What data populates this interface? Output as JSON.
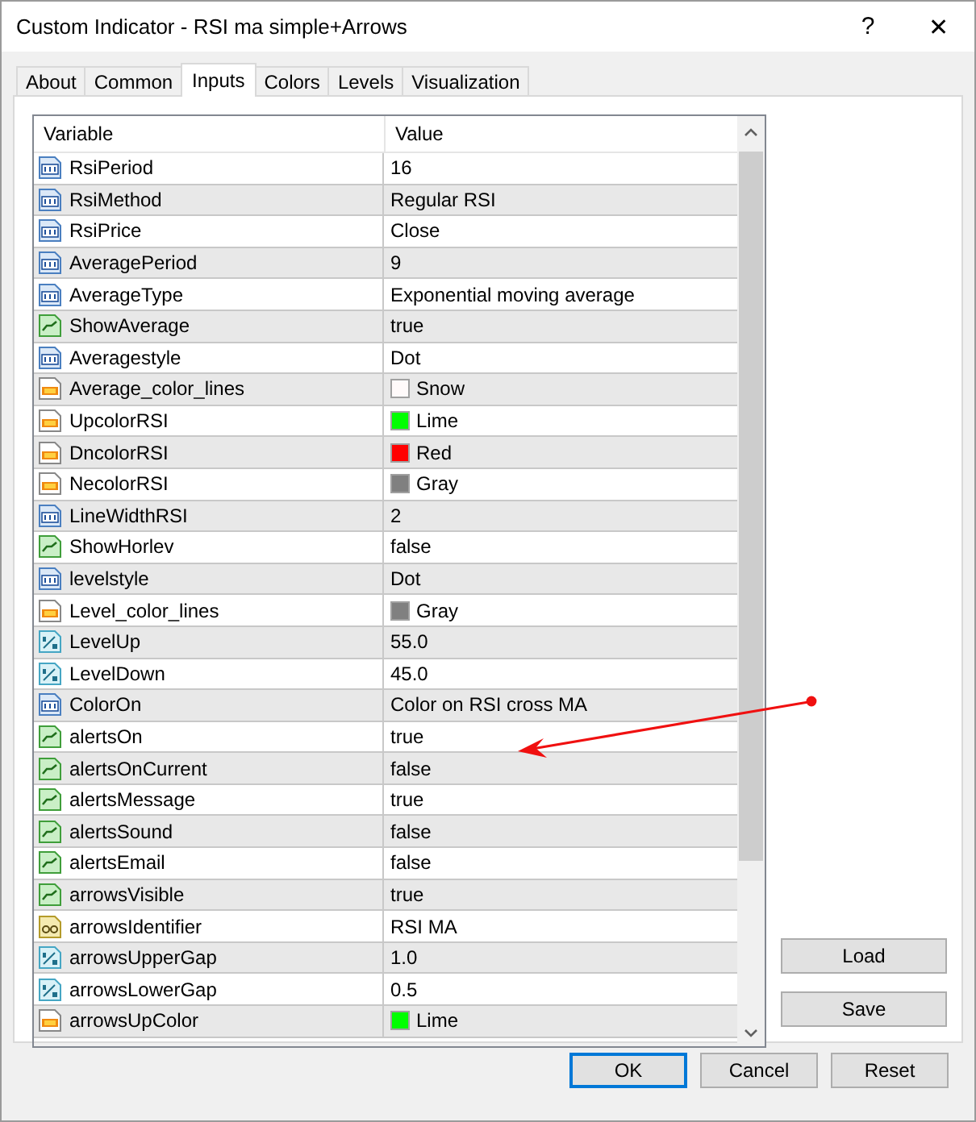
{
  "window": {
    "title": "Custom Indicator - RSI ma simple+Arrows",
    "help": "?",
    "close": "✕"
  },
  "tabs": [
    {
      "label": "About",
      "selected": false
    },
    {
      "label": "Common",
      "selected": false
    },
    {
      "label": "Inputs",
      "selected": true
    },
    {
      "label": "Colors",
      "selected": false
    },
    {
      "label": "Levels",
      "selected": false
    },
    {
      "label": "Visualization",
      "selected": false
    }
  ],
  "table": {
    "columns": [
      "Variable",
      "Value"
    ],
    "rows": [
      {
        "kind": "int",
        "variable": "RsiPeriod",
        "value": "16"
      },
      {
        "kind": "int",
        "variable": "RsiMethod",
        "value": "Regular RSI"
      },
      {
        "kind": "int",
        "variable": "RsiPrice",
        "value": "Close"
      },
      {
        "kind": "int",
        "variable": "AveragePeriod",
        "value": "9"
      },
      {
        "kind": "int",
        "variable": "AverageType",
        "value": "Exponential moving average"
      },
      {
        "kind": "bool",
        "variable": "ShowAverage",
        "value": "true"
      },
      {
        "kind": "int",
        "variable": "Averagestyle",
        "value": "Dot"
      },
      {
        "kind": "color",
        "variable": "Average_color_lines",
        "value": "Snow",
        "color": "#fffafa"
      },
      {
        "kind": "color",
        "variable": "UpcolorRSI",
        "value": "Lime",
        "color": "#00ff00"
      },
      {
        "kind": "color",
        "variable": "DncolorRSI",
        "value": "Red",
        "color": "#ff0000"
      },
      {
        "kind": "color",
        "variable": "NecolorRSI",
        "value": "Gray",
        "color": "#808080"
      },
      {
        "kind": "int",
        "variable": "LineWidthRSI",
        "value": "2"
      },
      {
        "kind": "bool",
        "variable": "ShowHorlev",
        "value": "false"
      },
      {
        "kind": "int",
        "variable": "levelstyle",
        "value": "Dot"
      },
      {
        "kind": "color",
        "variable": "Level_color_lines",
        "value": "Gray",
        "color": "#808080"
      },
      {
        "kind": "double",
        "variable": "LevelUp",
        "value": "55.0"
      },
      {
        "kind": "double",
        "variable": "LevelDown",
        "value": "45.0"
      },
      {
        "kind": "int",
        "variable": "ColorOn",
        "value": "Color on RSI cross MA"
      },
      {
        "kind": "bool",
        "variable": "alertsOn",
        "value": "true"
      },
      {
        "kind": "bool",
        "variable": "alertsOnCurrent",
        "value": "false"
      },
      {
        "kind": "bool",
        "variable": "alertsMessage",
        "value": "true"
      },
      {
        "kind": "bool",
        "variable": "alertsSound",
        "value": "false"
      },
      {
        "kind": "bool",
        "variable": "alertsEmail",
        "value": "false"
      },
      {
        "kind": "bool",
        "variable": "arrowsVisible",
        "value": "true"
      },
      {
        "kind": "string",
        "variable": "arrowsIdentifier",
        "value": " RSI MA"
      },
      {
        "kind": "double",
        "variable": "arrowsUpperGap",
        "value": "1.0"
      },
      {
        "kind": "double",
        "variable": "arrowsLowerGap",
        "value": "0.5"
      },
      {
        "kind": "color",
        "variable": "arrowsUpColor",
        "value": "Lime",
        "color": "#00ff00"
      }
    ]
  },
  "side_buttons": [
    "Load",
    "Save"
  ],
  "footer_buttons": [
    {
      "label": "OK",
      "default": true
    },
    {
      "label": "Cancel",
      "default": false
    },
    {
      "label": "Reset",
      "default": false
    }
  ]
}
